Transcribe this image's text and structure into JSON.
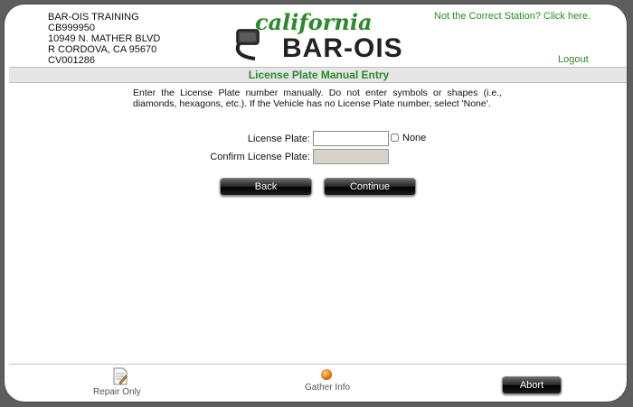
{
  "station": {
    "name": "BAR-OIS TRAINING",
    "id": "CB999950",
    "address": "10949 N. MATHER BLVD",
    "city": "R CORDOVA, CA 95670",
    "code": "CV001286"
  },
  "logo": {
    "script_text": "california",
    "brand_text": "BAR-OIS"
  },
  "header": {
    "wrong_station_link": "Not the Correct Station? Click here.",
    "logout_link": "Logout"
  },
  "page": {
    "title": "License Plate Manual Entry",
    "instructions": "Enter the License Plate number manually. Do not enter symbols or shapes (i.e., diamonds, hexagons, etc.). If the Vehicle has no License Plate number, select 'None'."
  },
  "form": {
    "license_plate_label": "License Plate:",
    "license_plate_value": "",
    "confirm_label": "Confirm License Plate:",
    "confirm_value": "",
    "none_label": "None",
    "none_checked": false
  },
  "buttons": {
    "back": "Back",
    "continue": "Continue",
    "abort": "Abort"
  },
  "footer": {
    "repair_only": "Repair Only",
    "gather_info": "Gather Info"
  },
  "icons": {
    "repair": "document-pencil-icon",
    "gather": "orange-dot-icon"
  },
  "colors": {
    "accent_green": "#2a8a2a",
    "title_bar": "#e6e6e6",
    "frame_bg": "#5e5e5e",
    "gather_orange": "#f08a1c"
  }
}
